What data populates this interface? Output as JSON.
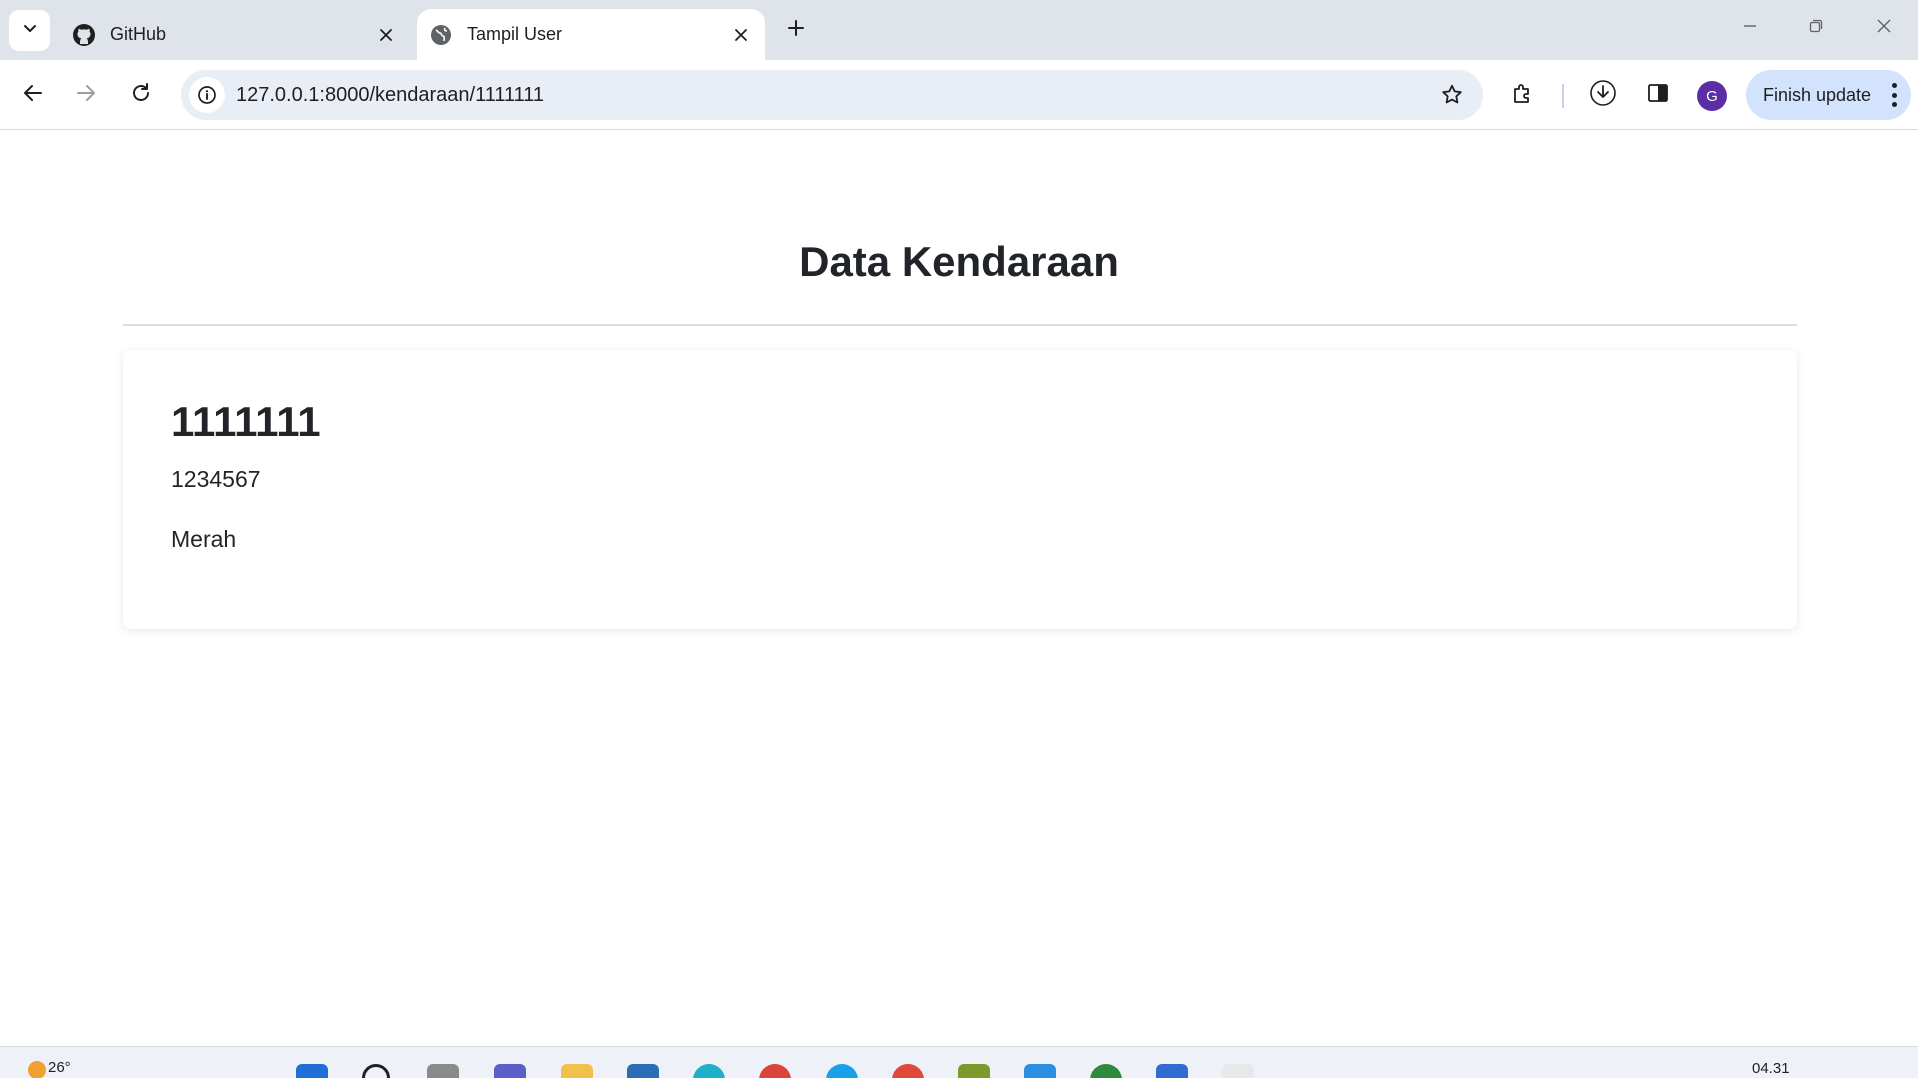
{
  "browser": {
    "tabs": [
      {
        "title": "GitHub",
        "icon": "github-icon",
        "active": false
      },
      {
        "title": "Tampil User",
        "icon": "globe-icon",
        "active": true
      }
    ],
    "url": "127.0.0.1:8000/kendaraan/1111111",
    "avatar_letter": "G",
    "finish_update_label": "Finish update",
    "colors": {
      "tabstrip": "#dfe3ea",
      "omnibox": "#e9eef6",
      "finish_button": "#d3e3fd",
      "avatar": "#5b2ea6"
    }
  },
  "page": {
    "title": "Data Kendaraan",
    "card": {
      "heading": "1111111",
      "line1": "1234567",
      "line2": "Merah"
    }
  },
  "taskbar": {
    "temperature": "26°",
    "clock": "04.31"
  }
}
